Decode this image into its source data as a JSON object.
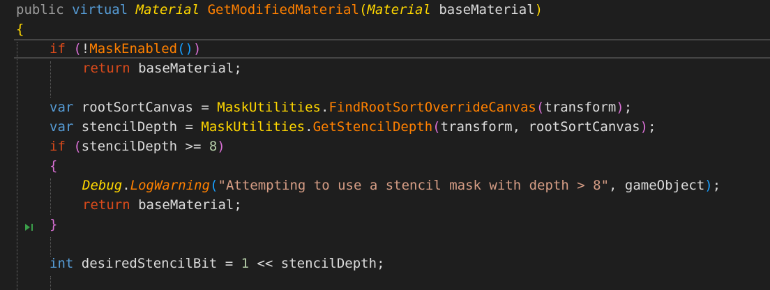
{
  "editor": {
    "lines": {
      "l1": {
        "public": "public",
        "virtual": "virtual",
        "rettype": "Material",
        "method": "GetModifiedMaterial",
        "open": "(",
        "ptype": "Material",
        "pname": "baseMaterial",
        "close": ")"
      },
      "l2": {
        "brace": "{"
      },
      "l3": {
        "if": "if",
        "open": "(",
        "not": "!",
        "fn": "MaskEnabled",
        "parens": "()",
        "close": ")"
      },
      "l4": {
        "return": "return",
        "id": "baseMaterial",
        "semi": ";"
      },
      "l6": {
        "var": "var",
        "name": "rootSortCanvas",
        "eq": " = ",
        "cls": "MaskUtilities",
        "dot": ".",
        "fn": "FindRootSortOverrideCanvas",
        "open": "(",
        "arg": "transform",
        "close": ")",
        "semi": ";"
      },
      "l7": {
        "var": "var",
        "name": "stencilDepth",
        "eq": " = ",
        "cls": "MaskUtilities",
        "dot": ".",
        "fn": "GetStencilDepth",
        "open": "(",
        "arg1": "transform",
        "comma": ", ",
        "arg2": "rootSortCanvas",
        "close": ")",
        "semi": ";"
      },
      "l8": {
        "if": "if",
        "open": "(",
        "id": "stencilDepth",
        "op": " >= ",
        "num": "8",
        "close": ")"
      },
      "l9": {
        "brace": "{"
      },
      "l10": {
        "cls": "Debug",
        "dot": ".",
        "fn": "LogWarning",
        "open": "(",
        "str": "\"Attempting to use a stencil mask with depth > 8\"",
        "comma": ", ",
        "arg": "gameObject",
        "close": ")",
        "semi": ";"
      },
      "l11": {
        "return": "return",
        "id": "baseMaterial",
        "semi": ";"
      },
      "l12": {
        "brace": "}"
      },
      "l14": {
        "type": "int",
        "name": "desiredStencilBit",
        "eq": " = ",
        "num": "1",
        "op": " << ",
        "id": "stencilDepth",
        "semi": ";"
      }
    }
  }
}
